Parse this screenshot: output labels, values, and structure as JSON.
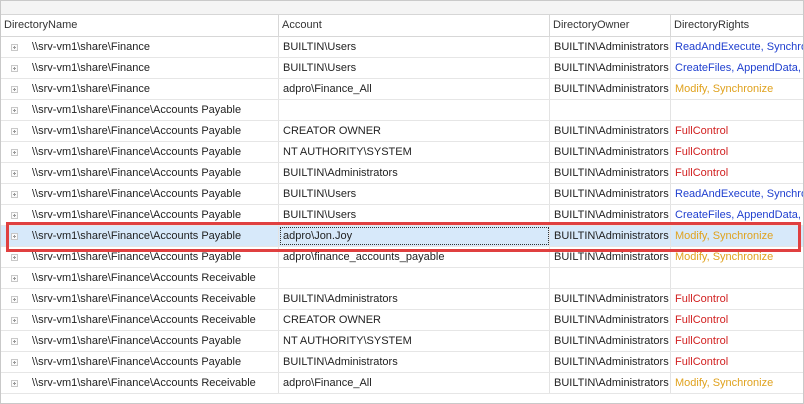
{
  "columns": [
    "DirectoryName",
    "Account",
    "DirectoryOwner",
    "DirectoryRights"
  ],
  "rows": [
    {
      "dir": "\\\\srv-vm1\\share\\Finance",
      "account": "BUILTIN\\Users",
      "owner": "BUILTIN\\Administrators",
      "rights": "ReadAndExecute, Synchro",
      "color": "blue"
    },
    {
      "dir": "\\\\srv-vm1\\share\\Finance",
      "account": "BUILTIN\\Users",
      "owner": "BUILTIN\\Administrators",
      "rights": "CreateFiles, AppendData,",
      "color": "blue"
    },
    {
      "dir": "\\\\srv-vm1\\share\\Finance",
      "account": "adpro\\Finance_All",
      "owner": "BUILTIN\\Administrators",
      "rights": "Modify, Synchronize",
      "color": "orange"
    },
    {
      "dir": "\\\\srv-vm1\\share\\Finance\\Accounts Payable",
      "account": "",
      "owner": "",
      "rights": "",
      "color": "none"
    },
    {
      "dir": "\\\\srv-vm1\\share\\Finance\\Accounts Payable",
      "account": "CREATOR OWNER",
      "owner": "BUILTIN\\Administrators",
      "rights": "FullControl",
      "color": "red"
    },
    {
      "dir": "\\\\srv-vm1\\share\\Finance\\Accounts Payable",
      "account": "NT AUTHORITY\\SYSTEM",
      "owner": "BUILTIN\\Administrators",
      "rights": "FullControl",
      "color": "red"
    },
    {
      "dir": "\\\\srv-vm1\\share\\Finance\\Accounts Payable",
      "account": "BUILTIN\\Administrators",
      "owner": "BUILTIN\\Administrators",
      "rights": "FullControl",
      "color": "red"
    },
    {
      "dir": "\\\\srv-vm1\\share\\Finance\\Accounts Payable",
      "account": "BUILTIN\\Users",
      "owner": "BUILTIN\\Administrators",
      "rights": "ReadAndExecute, Synchro",
      "color": "blue"
    },
    {
      "dir": "\\\\srv-vm1\\share\\Finance\\Accounts Payable",
      "account": "BUILTIN\\Users",
      "owner": "BUILTIN\\Administrators",
      "rights": "CreateFiles, AppendData,",
      "color": "blue"
    },
    {
      "dir": "\\\\srv-vm1\\share\\Finance\\Accounts Payable",
      "account": "adpro\\Jon.Joy",
      "owner": "BUILTIN\\Administrators",
      "rights": "Modify, Synchronize",
      "color": "orange",
      "selected": true
    },
    {
      "dir": "\\\\srv-vm1\\share\\Finance\\Accounts Payable",
      "account": "adpro\\finance_accounts_payable",
      "owner": "BUILTIN\\Administrators",
      "rights": "Modify, Synchronize",
      "color": "orange"
    },
    {
      "dir": "\\\\srv-vm1\\share\\Finance\\Accounts Receivable",
      "account": "",
      "owner": "",
      "rights": "",
      "color": "none"
    },
    {
      "dir": "\\\\srv-vm1\\share\\Finance\\Accounts Receivable",
      "account": "BUILTIN\\Administrators",
      "owner": "BUILTIN\\Administrators",
      "rights": "FullControl",
      "color": "red"
    },
    {
      "dir": "\\\\srv-vm1\\share\\Finance\\Accounts Receivable",
      "account": "CREATOR OWNER",
      "owner": "BUILTIN\\Administrators",
      "rights": "FullControl",
      "color": "red"
    },
    {
      "dir": "\\\\srv-vm1\\share\\Finance\\Accounts Payable",
      "account": "NT AUTHORITY\\SYSTEM",
      "owner": "BUILTIN\\Administrators",
      "rights": "FullControl",
      "color": "red"
    },
    {
      "dir": "\\\\srv-vm1\\share\\Finance\\Accounts Payable",
      "account": "BUILTIN\\Administrators",
      "owner": "BUILTIN\\Administrators",
      "rights": "FullControl",
      "color": "red"
    },
    {
      "dir": "\\\\srv-vm1\\share\\Finance\\Accounts Receivable",
      "account": "adpro\\Finance_All",
      "owner": "BUILTIN\\Administrators",
      "rights": "Modify, Synchronize",
      "color": "orange"
    }
  ],
  "colors": {
    "blue": "#1f3fcf",
    "orange": "#e0a21e",
    "red": "#d11f1f",
    "selection": "#d7e9fa",
    "highlight": "#e04040"
  }
}
